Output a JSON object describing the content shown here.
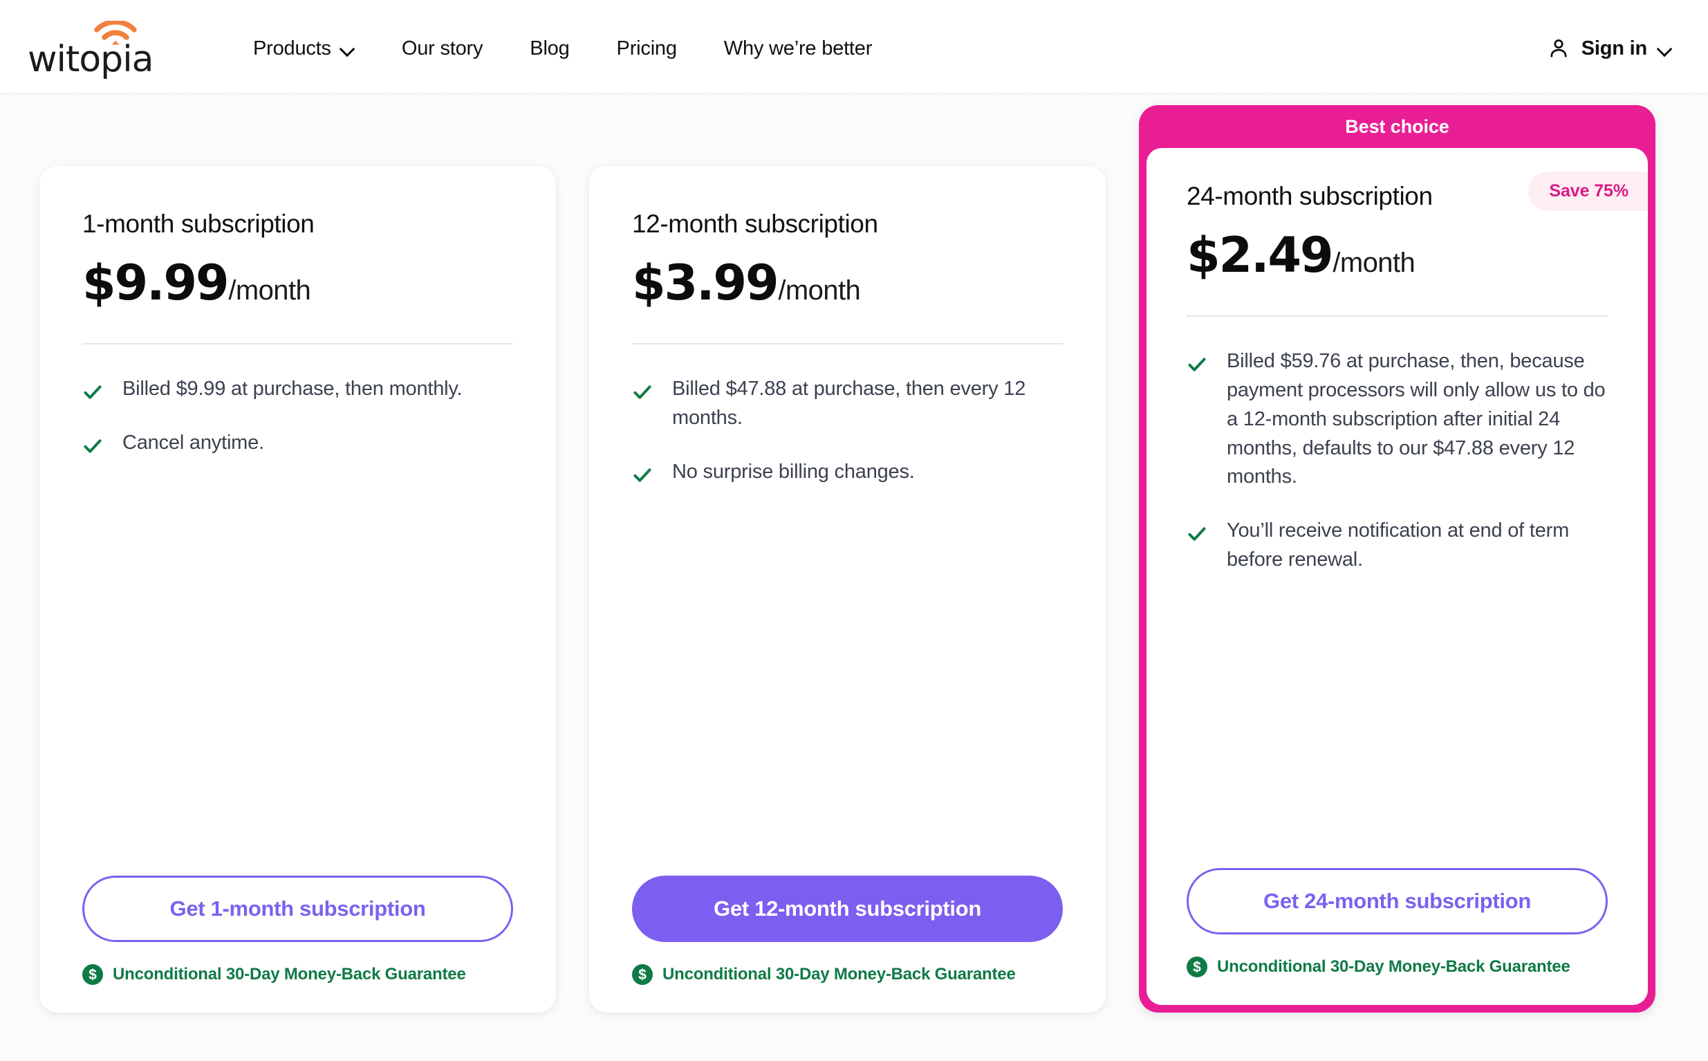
{
  "header": {
    "logo_text": "witopia",
    "logo_icon": "wifi-icon",
    "nav_items": [
      {
        "label": "Products",
        "has_dropdown": true
      },
      {
        "label": "Our story",
        "has_dropdown": false
      },
      {
        "label": "Blog",
        "has_dropdown": false
      },
      {
        "label": "Pricing",
        "has_dropdown": false
      },
      {
        "label": "Why we’re better",
        "has_dropdown": false
      }
    ],
    "signin": {
      "label": "Sign in",
      "icon": "user-icon",
      "chevron": "chevron-down-icon"
    }
  },
  "pricing": {
    "guarantee_label": "Unconditional 30-Day Money-Back Guarantee",
    "guarantee_icon": "dollar-circle-icon",
    "accent_purple": "#7c5ef0",
    "accent_pink": "#e91e95",
    "accent_green": "#0f7a46",
    "cards": [
      {
        "title": "1-month subscription",
        "price": "$9.99",
        "price_suffix": "/month",
        "features": [
          "Billed $9.99 at purchase, then monthly.",
          "Cancel anytime."
        ],
        "cta_label": "Get 1-month subscription",
        "cta_style": "outline"
      },
      {
        "title": "12-month subscription",
        "price": "$3.99",
        "price_suffix": "/month",
        "features": [
          "Billed $47.88 at purchase, then every 12 months.",
          "No surprise billing changes."
        ],
        "cta_label": "Get 12-month subscription",
        "cta_style": "solid"
      },
      {
        "banner": "Best choice",
        "badge": "Save 75%",
        "title": "24-month subscription",
        "price": "$2.49",
        "price_suffix": "/month",
        "features": [
          "Billed $59.76 at purchase, then, because payment processors will only allow us to do a 12-month subscription after initial 24 months, defaults to our $47.88 every 12 months.",
          "You’ll receive notification at end of term before renewal."
        ],
        "cta_label": "Get 24-month subscription",
        "cta_style": "outline"
      }
    ]
  }
}
